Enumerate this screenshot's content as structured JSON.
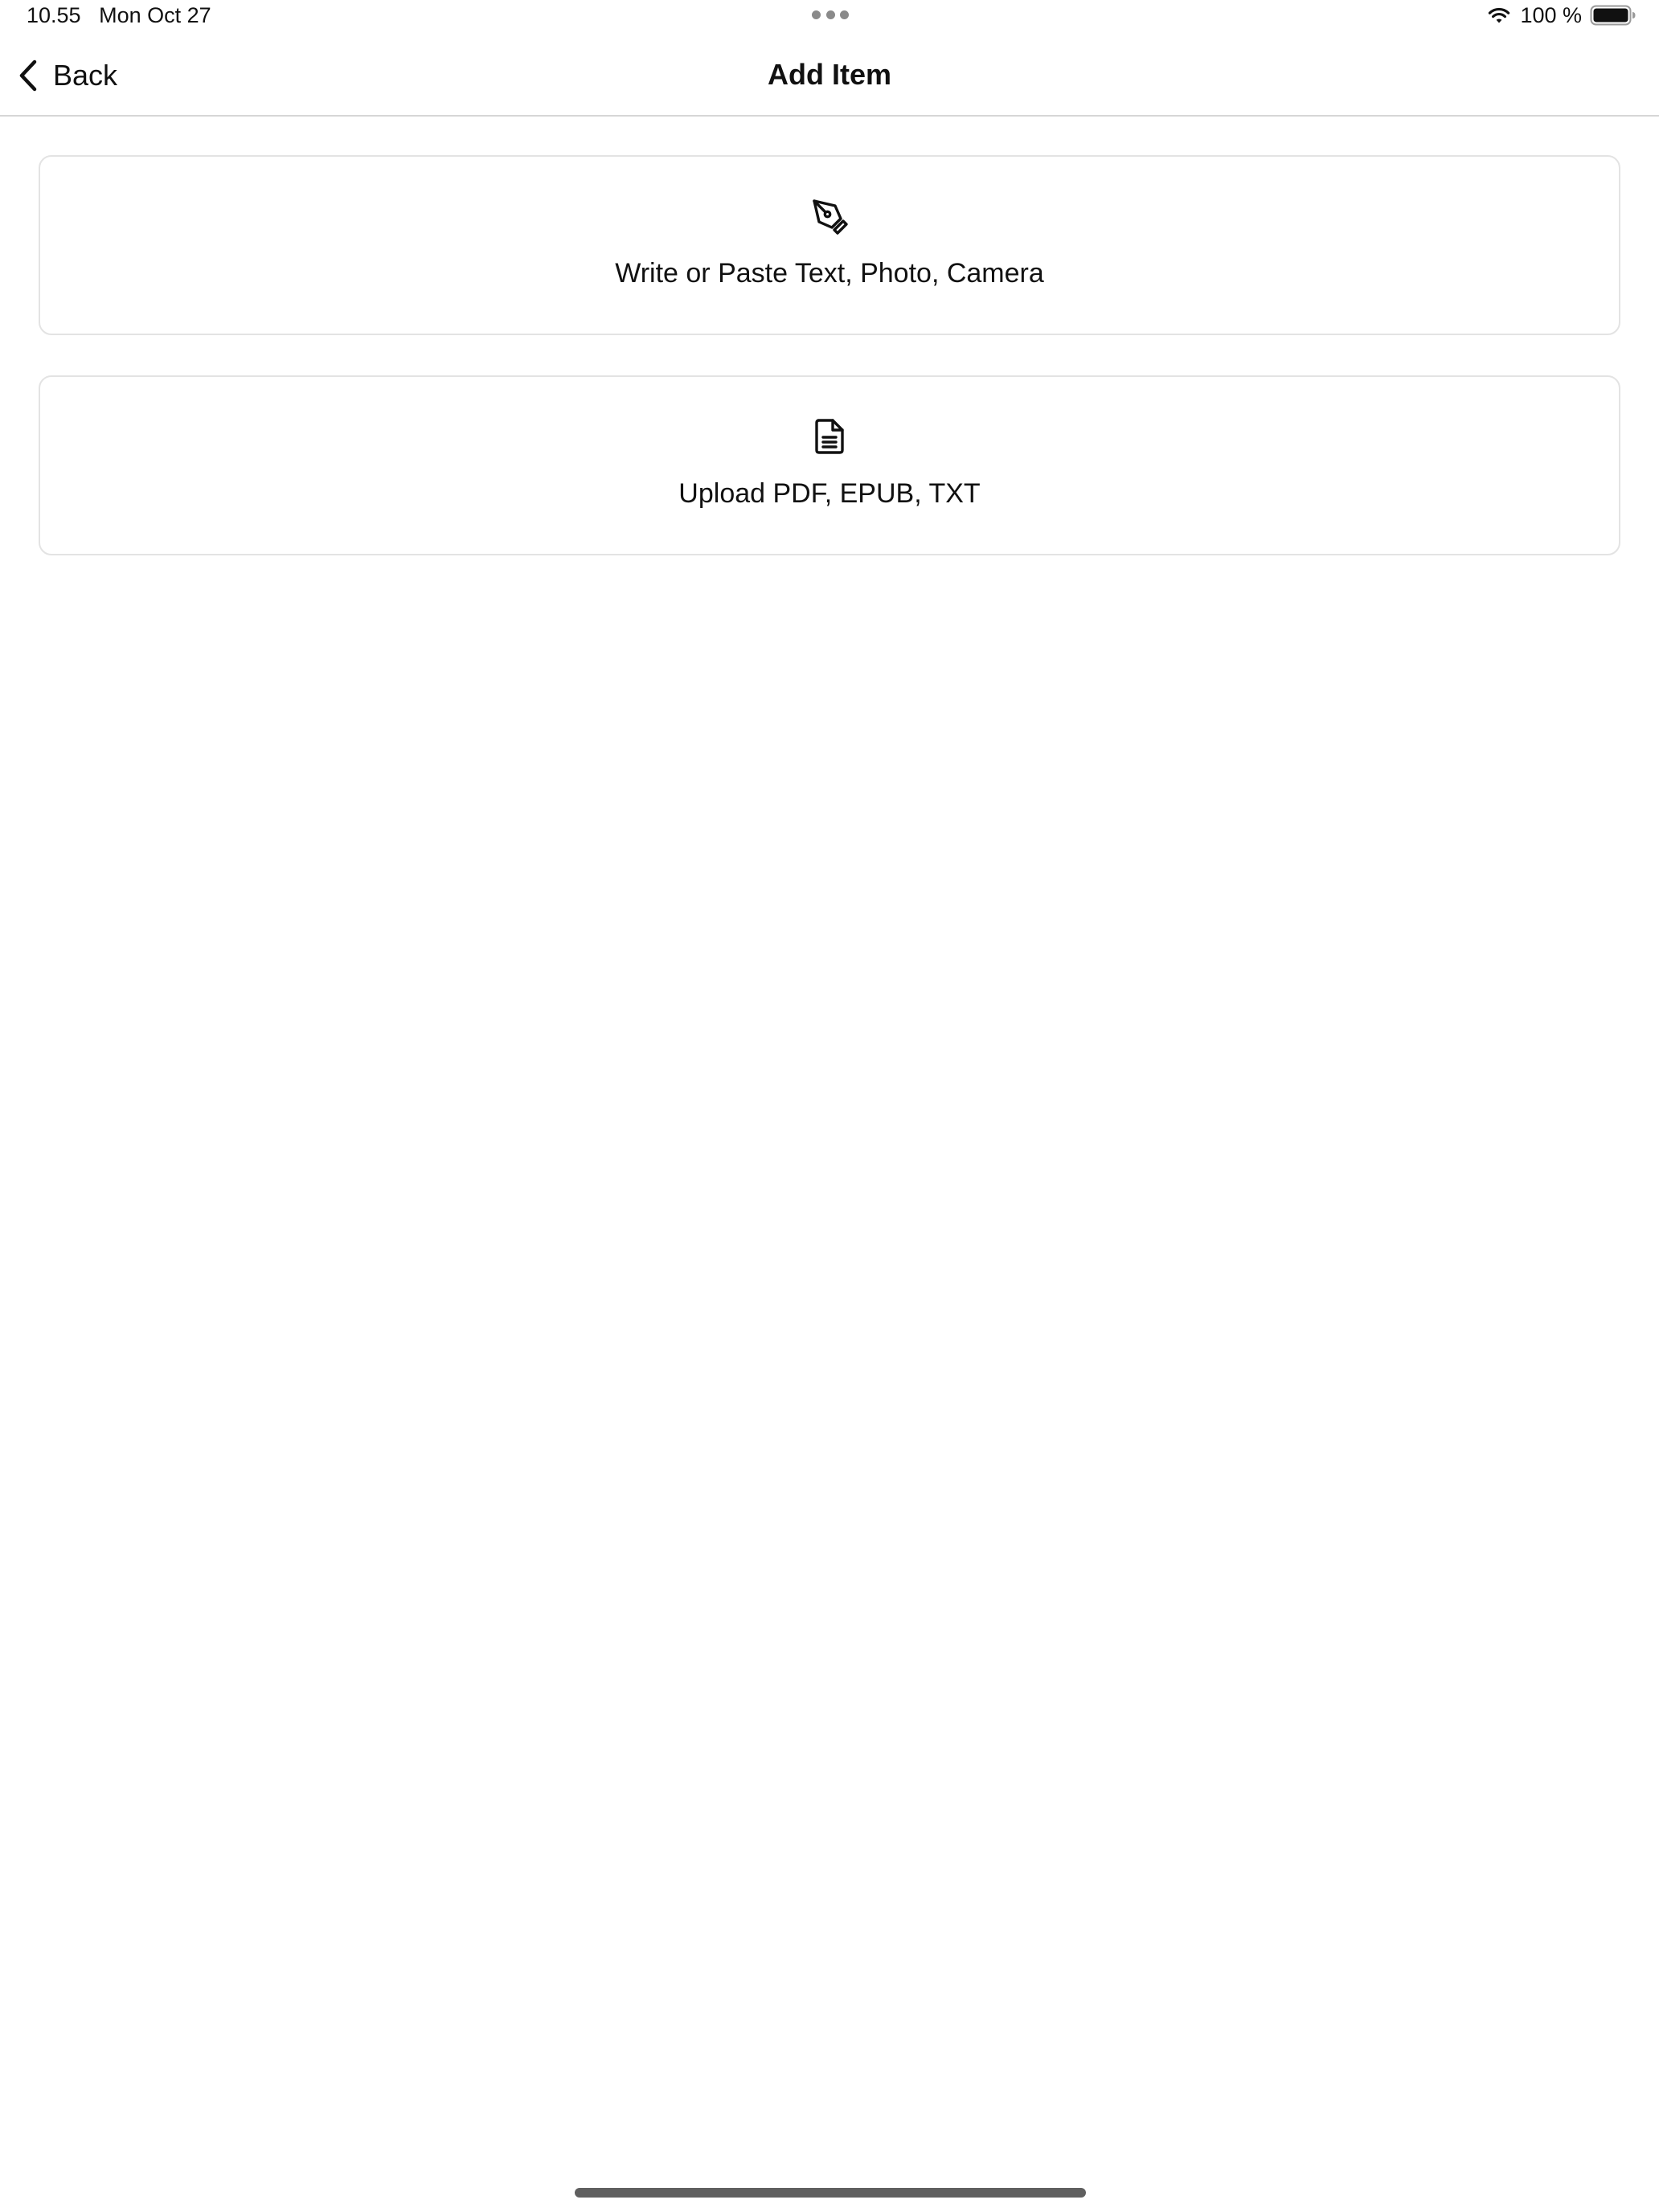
{
  "status_bar": {
    "time": "10.55",
    "date": "Mon Oct 27",
    "battery_percent": "100 %",
    "icons": [
      "multitasking-dots-icon",
      "wifi-icon",
      "battery-icon"
    ]
  },
  "nav": {
    "back_label": "Back",
    "title": "Add Item",
    "back_icon": "chevron-left-icon"
  },
  "options": [
    {
      "label": "Write or Paste Text, Photo, Camera",
      "icon": "pen-nib-icon"
    },
    {
      "label": "Upload PDF, EPUB, TXT",
      "icon": "document-icon"
    }
  ],
  "colors": {
    "background": "#ffffff",
    "text": "#111111",
    "card_border": "#e3e3e3",
    "divider": "#d6d6d6"
  }
}
